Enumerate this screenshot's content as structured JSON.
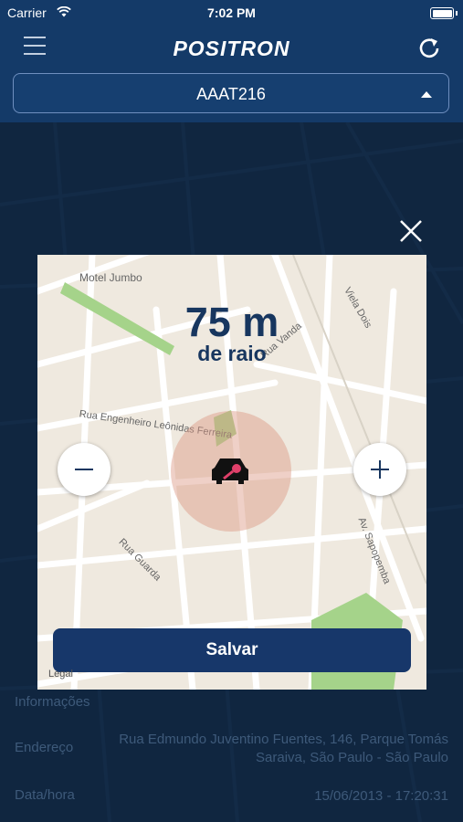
{
  "status_bar": {
    "carrier": "Carrier",
    "time": "7:02 PM"
  },
  "header": {
    "logo": "POSITRON",
    "vehicle_plate": "AAAT216"
  },
  "modal": {
    "radius_value": "75 m",
    "radius_label": "de raio",
    "save_label": "Salvar",
    "map_legal": "Legal",
    "map_labels": {
      "motel": "Motel Jumbo",
      "rua_engenheiro": "Rua Engenheiro Leônidas Ferreira",
      "rua_guarda": "Rua Guarda",
      "av_sapopemba": "Av. Sapopemba",
      "viela_dois": "Viela Dois",
      "vanda": "Rua Vanda"
    }
  },
  "info": {
    "section_title": "Informações",
    "endereco_label": "Endereço",
    "endereco_value": "Rua Edmundo Juventino Fuentes, 146, Parque Tomás Saraiva, São Paulo - São Paulo",
    "datahora_label": "Data/hora",
    "datahora_value": "15/06/2013 - 17:20:31"
  },
  "colors": {
    "header_bg": "#143a68",
    "accent_navy": "#17376a",
    "map_bg": "#efe9df",
    "radius_fill": "#dc9682"
  },
  "icons": [
    "wifi-icon",
    "battery-icon",
    "hamburger-menu-icon",
    "refresh-icon",
    "chevron-up-icon",
    "close-icon",
    "car-key-icon",
    "minus-icon",
    "plus-icon"
  ]
}
